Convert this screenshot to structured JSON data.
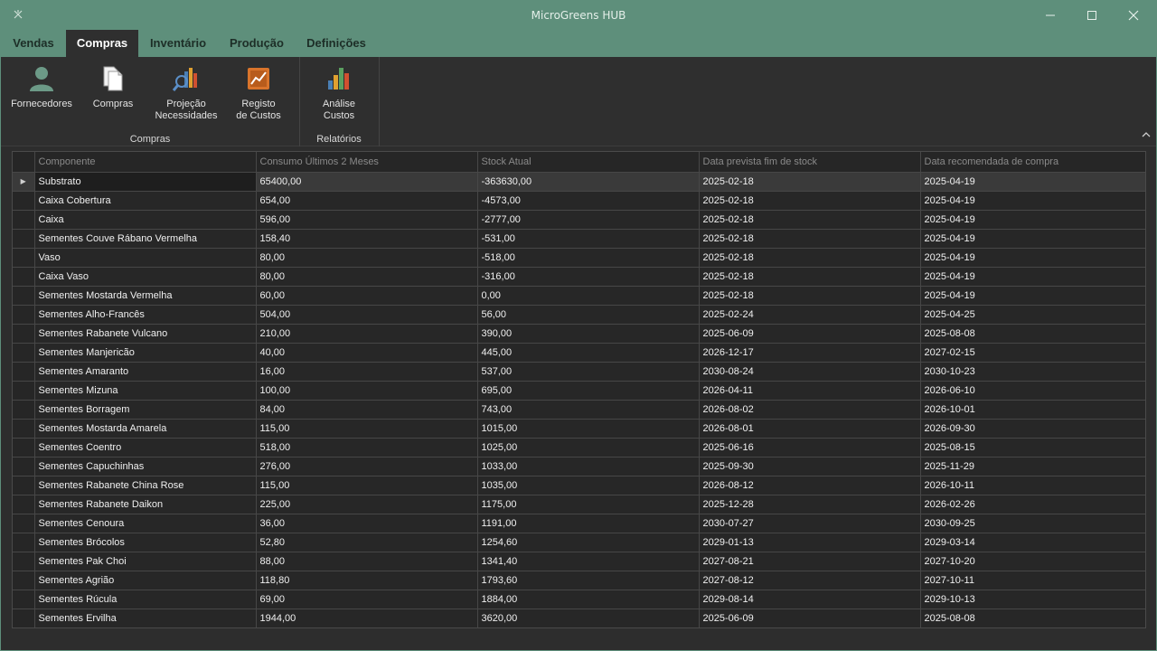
{
  "window": {
    "title": "MicroGreens HUB"
  },
  "tabs": [
    {
      "label": "Vendas"
    },
    {
      "label": "Compras"
    },
    {
      "label": "Inventário"
    },
    {
      "label": "Produção"
    },
    {
      "label": "Definições"
    }
  ],
  "ribbon": {
    "groups": [
      {
        "label": "Compras",
        "buttons": [
          {
            "label": "Fornecedores",
            "icon": "person-icon"
          },
          {
            "label": "Compras",
            "icon": "documents-icon"
          },
          {
            "label_line1": "Projeção",
            "label_line2": "Necessidades",
            "icon": "chart-search-icon"
          },
          {
            "label_line1": "Registo",
            "label_line2": "de Custos",
            "icon": "trend-chart-icon"
          }
        ]
      },
      {
        "label": "Relatórios",
        "buttons": [
          {
            "label_line1": "Análise",
            "label_line2": "Custos",
            "icon": "bar-chart-icon"
          }
        ]
      }
    ]
  },
  "grid": {
    "columns": [
      "Componente",
      "Consumo Últimos 2 Meses",
      "Stock Atual",
      "Data prevista fim de stock",
      "Data recomendada de compra"
    ],
    "selected_marker": "▶",
    "rows": [
      [
        "Substrato",
        "65400,00",
        "-363630,00",
        "2025-02-18",
        "2025-04-19"
      ],
      [
        "Caixa Cobertura",
        "654,00",
        "-4573,00",
        "2025-02-18",
        "2025-04-19"
      ],
      [
        "Caixa",
        "596,00",
        "-2777,00",
        "2025-02-18",
        "2025-04-19"
      ],
      [
        "Sementes Couve Rábano Vermelha",
        "158,40",
        "-531,00",
        "2025-02-18",
        "2025-04-19"
      ],
      [
        "Vaso",
        "80,00",
        "-518,00",
        "2025-02-18",
        "2025-04-19"
      ],
      [
        "Caixa Vaso",
        "80,00",
        "-316,00",
        "2025-02-18",
        "2025-04-19"
      ],
      [
        "Sementes Mostarda Vermelha",
        "60,00",
        "0,00",
        "2025-02-18",
        "2025-04-19"
      ],
      [
        "Sementes Alho-Francês",
        "504,00",
        "56,00",
        "2025-02-24",
        "2025-04-25"
      ],
      [
        "Sementes Rabanete Vulcano",
        "210,00",
        "390,00",
        "2025-06-09",
        "2025-08-08"
      ],
      [
        "Sementes Manjericão",
        "40,00",
        "445,00",
        "2026-12-17",
        "2027-02-15"
      ],
      [
        "Sementes Amaranto",
        "16,00",
        "537,00",
        "2030-08-24",
        "2030-10-23"
      ],
      [
        "Sementes Mizuna",
        "100,00",
        "695,00",
        "2026-04-11",
        "2026-06-10"
      ],
      [
        "Sementes Borragem",
        "84,00",
        "743,00",
        "2026-08-02",
        "2026-10-01"
      ],
      [
        "Sementes Mostarda Amarela",
        "115,00",
        "1015,00",
        "2026-08-01",
        "2026-09-30"
      ],
      [
        "Sementes Coentro",
        "518,00",
        "1025,00",
        "2025-06-16",
        "2025-08-15"
      ],
      [
        "Sementes Capuchinhas",
        "276,00",
        "1033,00",
        "2025-09-30",
        "2025-11-29"
      ],
      [
        "Sementes Rabanete China Rose",
        "115,00",
        "1035,00",
        "2026-08-12",
        "2026-10-11"
      ],
      [
        "Sementes Rabanete Daikon",
        "225,00",
        "1175,00",
        "2025-12-28",
        "2026-02-26"
      ],
      [
        "Sementes Cenoura",
        "36,00",
        "1191,00",
        "2030-07-27",
        "2030-09-25"
      ],
      [
        "Sementes Brócolos",
        "52,80",
        "1254,60",
        "2029-01-13",
        "2029-03-14"
      ],
      [
        "Sementes Pak Choi",
        "88,00",
        "1341,40",
        "2027-08-21",
        "2027-10-20"
      ],
      [
        "Sementes Agrião",
        "118,80",
        "1793,60",
        "2027-08-12",
        "2027-10-11"
      ],
      [
        "Sementes Rúcula",
        "69,00",
        "1884,00",
        "2029-08-14",
        "2029-10-13"
      ],
      [
        "Sementes Ervilha",
        "1944,00",
        "3620,00",
        "2025-06-09",
        "2025-08-08"
      ]
    ]
  },
  "colors": {
    "accent": "#5e8f7b",
    "background": "#2d2d2d",
    "grid_line": "#474747"
  }
}
